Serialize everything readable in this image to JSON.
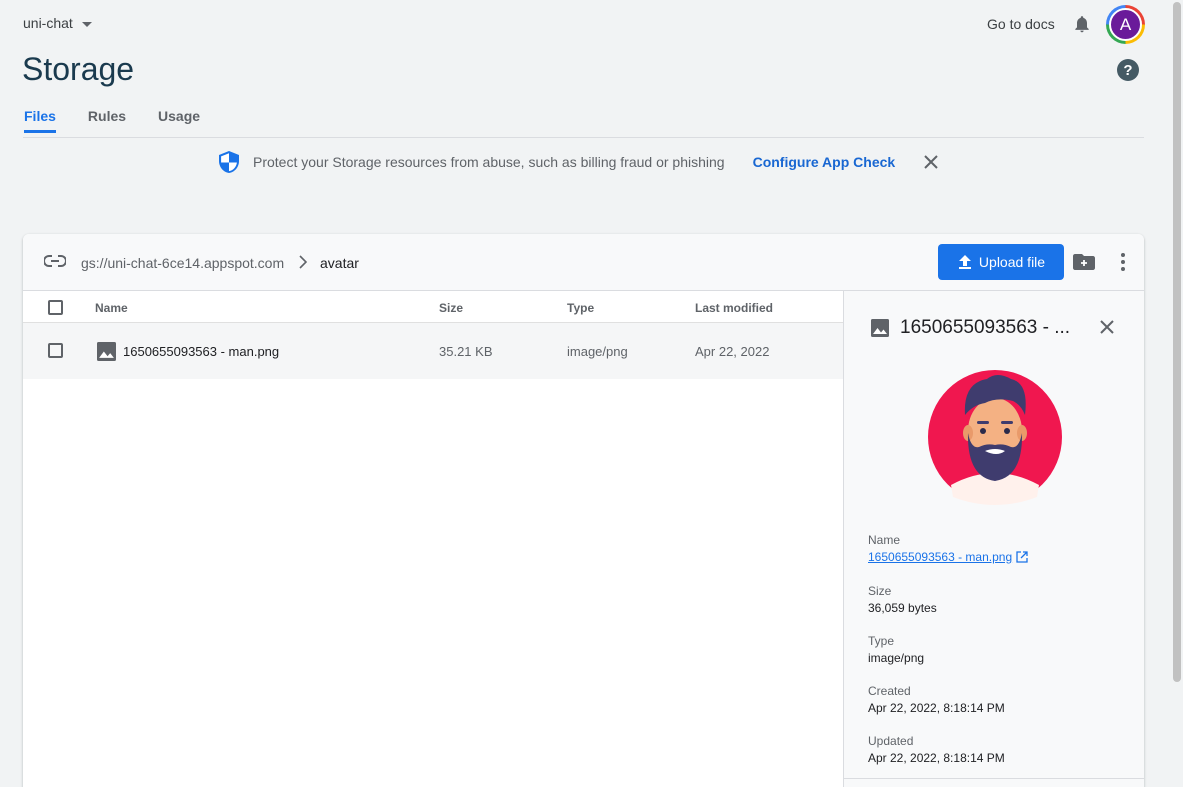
{
  "header": {
    "project": "uni-chat",
    "docs_link": "Go to docs",
    "avatar_letter": "A",
    "title": "Storage",
    "help": "?"
  },
  "tabs": [
    {
      "label": "Files",
      "active": true
    },
    {
      "label": "Rules",
      "active": false
    },
    {
      "label": "Usage",
      "active": false
    }
  ],
  "banner": {
    "message": "Protect your Storage resources from abuse, such as billing fraud or phishing",
    "action": "Configure App Check"
  },
  "browser": {
    "bucket": "gs://uni-chat-6ce14.appspot.com",
    "folder": "avatar",
    "upload_label": "Upload file",
    "columns": [
      "Name",
      "Size",
      "Type",
      "Last modified"
    ],
    "rows": [
      {
        "name": "1650655093563 - man.png",
        "size": "35.21 KB",
        "type": "image/png",
        "modified": "Apr 22, 2022"
      }
    ]
  },
  "details": {
    "title": "1650655093563 - ...",
    "name_label": "Name",
    "name_value": "1650655093563 - man.png",
    "size_label": "Size",
    "size_value": "36,059 bytes",
    "type_label": "Type",
    "type_value": "image/png",
    "created_label": "Created",
    "created_value": "Apr 22, 2022, 8:18:14 PM",
    "updated_label": "Updated",
    "updated_value": "Apr 22, 2022, 8:18:14 PM"
  },
  "colors": {
    "accent": "#1a73e8",
    "title": "#1a3a4e",
    "avatar_bg": "#6a1b9a",
    "preview_circle": "#f0174f"
  }
}
